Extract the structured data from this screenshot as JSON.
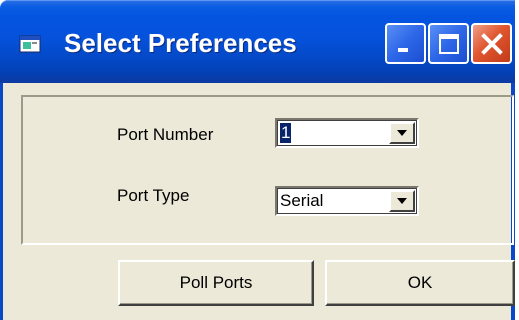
{
  "window": {
    "title": "Select Preferences",
    "colors": {
      "titlebar": "#0554e0",
      "body": "#ece9d8",
      "close": "#e0562f"
    }
  },
  "titlebar_buttons": {
    "minimize_icon": "minimize-icon",
    "maximize_icon": "maximize-icon",
    "close_icon": "close-icon"
  },
  "form": {
    "port_number": {
      "label": "Port Number",
      "value": "1"
    },
    "port_type": {
      "label": "Port Type",
      "value": "Serial"
    }
  },
  "buttons": {
    "poll_ports": "Poll Ports",
    "ok": "OK"
  }
}
